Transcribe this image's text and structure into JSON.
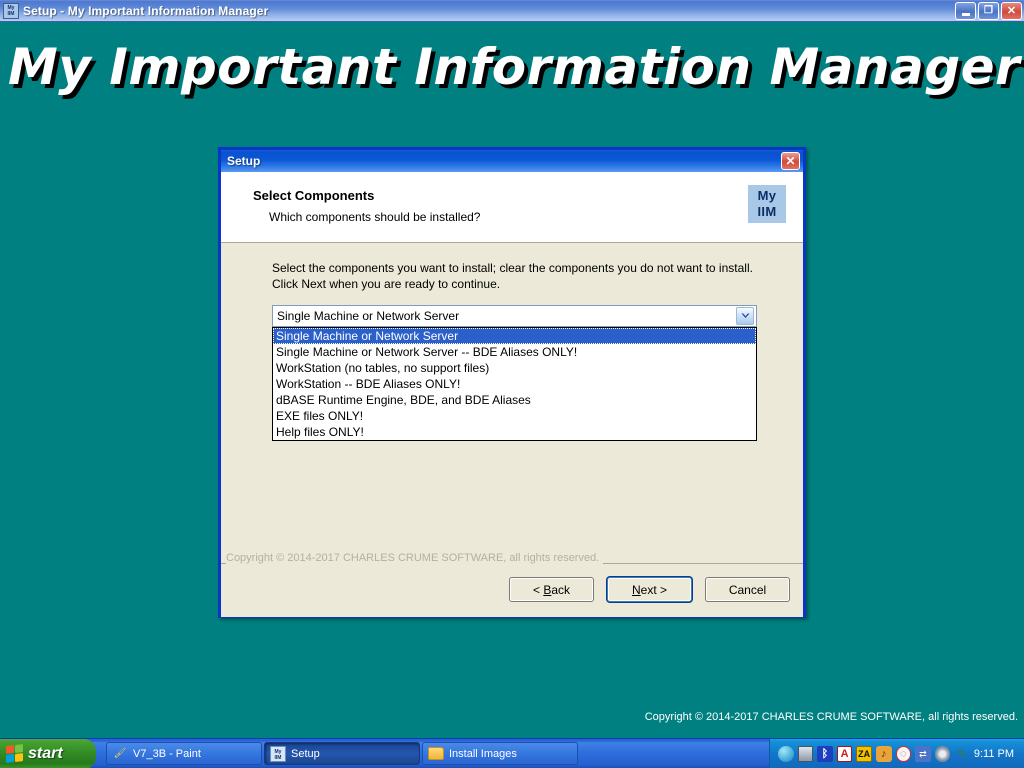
{
  "window": {
    "title": "Setup - My Important Information Manager",
    "icon": "my-iim-icon",
    "icon_line1": "My",
    "icon_line2": "IIM",
    "minimize_label": "_",
    "maximize_label": "❐",
    "close_label": "✕"
  },
  "banner": {
    "text": "My Important Information Manager"
  },
  "desktop": {
    "background_color": "#008080",
    "copyright": "Copyright © 2014-2017 CHARLES CRUME SOFTWARE, all rights reserved."
  },
  "dialog": {
    "title": "Setup",
    "close_label": "✕",
    "header": {
      "title": "Select Components",
      "subtitle": "Which components should be installed?",
      "logo_line1": "My",
      "logo_line2": "IIM"
    },
    "body": {
      "instructions": "Select the components you want to install; clear the components you do not want to install. Click Next when you are ready to continue.",
      "combo": {
        "selected_value": "Single Machine or Network Server",
        "arrow_icon": "chevron-down-icon",
        "options": [
          "Single Machine or Network Server",
          "Single Machine or Network Server -- BDE Aliases ONLY!",
          "WorkStation (no tables, no support files)",
          "WorkStation -- BDE Aliases ONLY!",
          "dBASE Runtime Engine, BDE, and BDE Aliases",
          "EXE files ONLY!",
          "Help files ONLY!"
        ],
        "selected_index": 0
      }
    },
    "footer": {
      "copyright": "Copyright © 2014-2017 CHARLES CRUME SOFTWARE, all rights reserved.",
      "buttons": [
        {
          "name": "back-button",
          "label": "< Back",
          "focused": false
        },
        {
          "name": "next-button",
          "label": "Next >",
          "focused": true
        },
        {
          "name": "cancel-button",
          "label": "Cancel",
          "focused": false
        }
      ]
    }
  },
  "taskbar": {
    "start_label": "start",
    "items": [
      {
        "label": "V7_3B - Paint",
        "icon": "paint-icon",
        "active": false
      },
      {
        "label": "Setup",
        "icon": "my-iim-icon",
        "active": true
      },
      {
        "label": "Install Images",
        "icon": "folder-icon",
        "active": false
      }
    ],
    "tray": {
      "icons": [
        "network-globe-icon",
        "display-icon",
        "bluetooth-icon",
        "antivirus-a-icon",
        "za-firewall-icon",
        "speaker-icon",
        "shield-icon",
        "network-connection-icon",
        "disc-icon",
        "pen-icon"
      ],
      "clock": "9:11 PM"
    }
  },
  "colors": {
    "desktop": "#008080",
    "dialog_body": "#ece9d8",
    "titlebar_blue": "#0a52cf",
    "selection_blue": "#2b5fc9",
    "taskbar_blue": "#2f6fdd",
    "start_green": "#3f9c2d"
  }
}
